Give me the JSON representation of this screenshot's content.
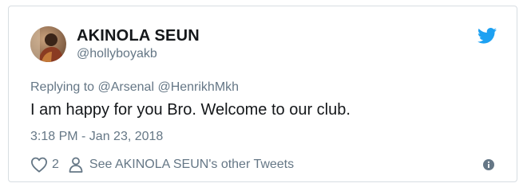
{
  "author": {
    "display_name": "AKINOLA SEUN",
    "handle": "@hollyboyakb",
    "avatar_icon": "profile-photo"
  },
  "brand": {
    "icon": "twitter-bird-icon",
    "color": "#1da1f2"
  },
  "reply": {
    "prefix": "Replying to",
    "mentions": [
      "@Arsenal",
      "@HenrikhMkh"
    ]
  },
  "tweet": {
    "text": "I am happy for you Bro. Welcome to our club.",
    "timestamp": "3:18 PM - Jan 23, 2018"
  },
  "actions": {
    "like_count": "2",
    "other_tweets_label": "See AKINOLA SEUN's other Tweets",
    "info_icon": "info-icon"
  }
}
